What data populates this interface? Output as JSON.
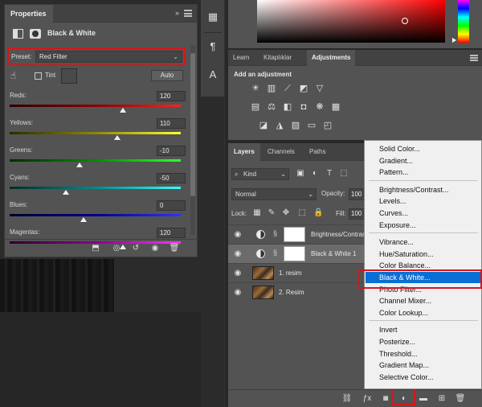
{
  "properties": {
    "tab_label": "Properties",
    "collapse_glyph": "»",
    "title": "Black & White",
    "preset_label": "Preset:",
    "preset_value": "Red Filter",
    "tint_label": "Tint",
    "auto_label": "Auto",
    "sliders": [
      {
        "label": "Reds:",
        "value": "120",
        "pct": 0.66
      },
      {
        "label": "Yellows:",
        "value": "110",
        "pct": 0.63
      },
      {
        "label": "Greens:",
        "value": "-10",
        "pct": 0.41
      },
      {
        "label": "Cyans:",
        "value": "-50",
        "pct": 0.33
      },
      {
        "label": "Blues:",
        "value": "0",
        "pct": 0.43
      },
      {
        "label": "Magentas:",
        "value": "120",
        "pct": 0.66
      }
    ],
    "icons": {
      "clip": "clip-to-layer-icon",
      "view_prev": "view-previous-icon",
      "reset": "reset-icon",
      "visibility": "visibility-eye-icon",
      "delete": "trash-icon"
    }
  },
  "tools": {
    "icons": [
      "libraries-icon",
      "paragraph-icon",
      "character-icon"
    ]
  },
  "adjustments_panel": {
    "tabs": [
      "Learn",
      "Kitaplıklar",
      "Adjustments"
    ],
    "active_tab": "Adjustments",
    "heading": "Add an adjustment"
  },
  "layers_panel": {
    "tabs": [
      "Layers",
      "Channels",
      "Paths"
    ],
    "active_tab": "Layers",
    "kind_label": "Kind",
    "blend_mode": "Normal",
    "opacity_label": "Opacity:",
    "opacity_value": "100",
    "lock_label": "Lock:",
    "fill_label": "Fill:",
    "fill_value": "100",
    "layers": [
      {
        "name": "Brightness/Contrast",
        "type": "adjustment"
      },
      {
        "name": "Black & White 1",
        "type": "adjustment",
        "selected": true
      },
      {
        "name": "1. resim",
        "type": "image"
      },
      {
        "name": "2. Resim",
        "type": "image"
      }
    ]
  },
  "adjustment_menu": {
    "groups": [
      [
        "Solid Color...",
        "Gradient...",
        "Pattern..."
      ],
      [
        "Brightness/Contrast...",
        "Levels...",
        "Curves...",
        "Exposure..."
      ],
      [
        "Vibrance...",
        "Hue/Saturation...",
        "Color Balance...",
        "Black & White...",
        "Photo Filter...",
        "Channel Mixer...",
        "Color Lookup..."
      ],
      [
        "Invert",
        "Posterize...",
        "Threshold...",
        "Gradient Map...",
        "Selective Color..."
      ]
    ],
    "highlighted": "Black & White..."
  },
  "colors": {
    "highlight_red": "#d4161c",
    "menu_selection": "#0a6fd4",
    "panel_bg": "#535353"
  }
}
